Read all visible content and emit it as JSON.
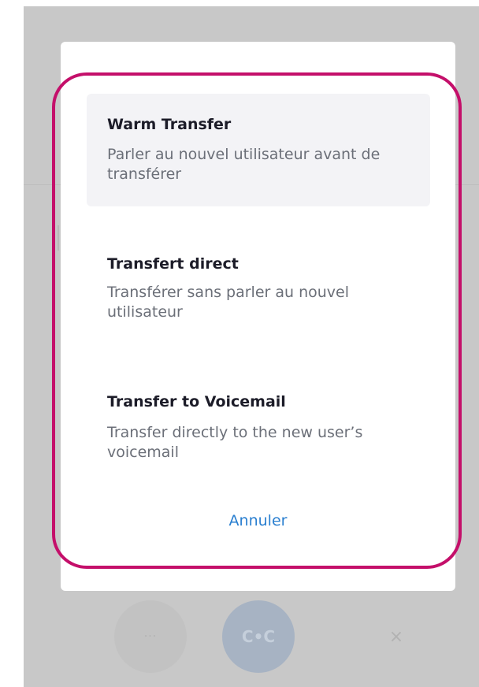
{
  "transfer_menu": {
    "options": [
      {
        "title": "Warm Transfer",
        "description": "Parler au nouvel utilisateur avant de transférer"
      },
      {
        "title": "Transfert direct",
        "description": "Transférer sans parler au nouvel utilisateur"
      },
      {
        "title": "Transfer to Voicemail",
        "description": "Transfer directly to the new user’s voicemail"
      }
    ],
    "cancel_label": "Annuler",
    "selected_index": 0
  },
  "call_controls": {
    "more_glyph": "···",
    "transfer_glyph": "C•C",
    "close_glyph": "×"
  },
  "colors": {
    "backdrop": "#c8c8c8",
    "highlight_outline": "#c40f6a",
    "cancel_link": "#2a7fd0",
    "selected_option_bg": "#f3f3f6"
  }
}
